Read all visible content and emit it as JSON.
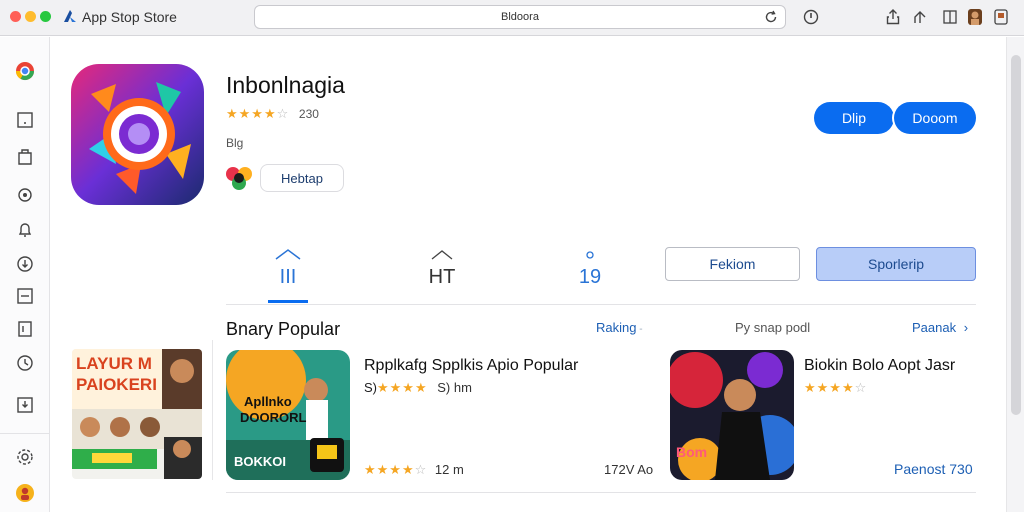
{
  "window": {
    "app_title": "App Stop Store",
    "url": "Bldoora"
  },
  "app": {
    "name": "Inbonlnagia",
    "rating_count": "230",
    "stars_full": 4,
    "age": "Blg",
    "developer": "Hebtap",
    "get_label": "Dlip",
    "open_label": "Dooom"
  },
  "stats": [
    {
      "label": "III"
    },
    {
      "label": "HT"
    },
    {
      "label": "19"
    }
  ],
  "segments": {
    "a": "Fekiom",
    "b": "Sporlerip"
  },
  "section": {
    "title": "Bnary Popular",
    "link1": "Raking",
    "muted": "Py snap podl",
    "link2": "Paanak",
    "chevron": "›"
  },
  "cards": [
    {
      "title": "Rpplkafg Spplkis Apio Popular",
      "sub_prefix": "S)",
      "sub_suffix": "S) hm",
      "meta_left": "12 m",
      "meta_right": "172V Ao",
      "thumb_text1": "Apllnko",
      "thumb_text2": "DOORORL",
      "thumb_text3": "BOKKOI"
    },
    {
      "title": "Biokin Bolo Aopt Jasr",
      "link": "Paenost 730",
      "thumb_text": "Bom"
    }
  ],
  "side_card": {
    "line1": "LAYUR M",
    "line2": "PAIOKERI"
  },
  "colors": {
    "accent": "#0a6cf0",
    "star": "#f5a623"
  }
}
